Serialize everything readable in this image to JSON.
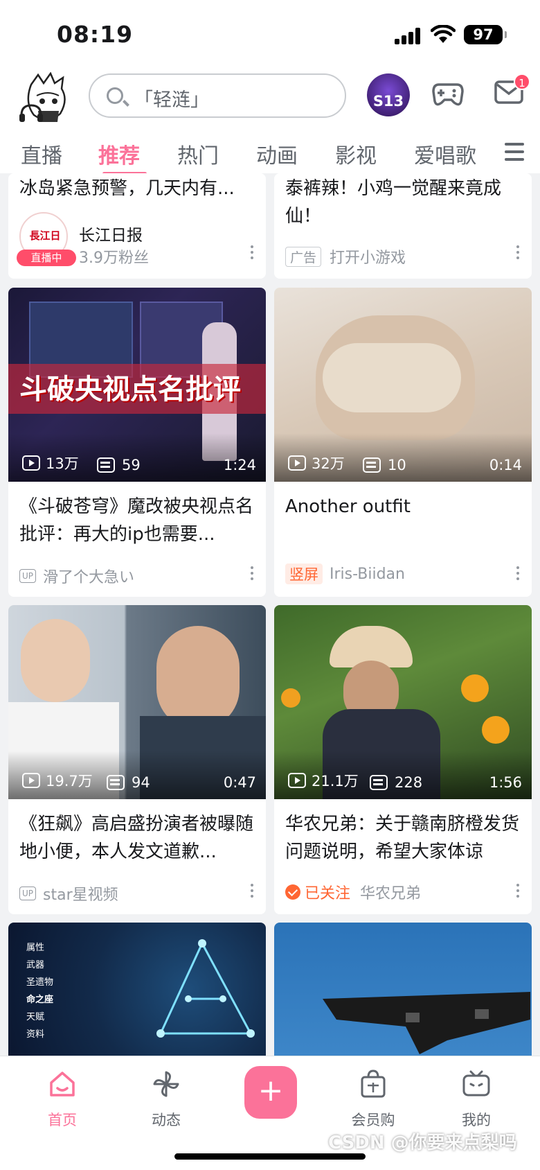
{
  "status_bar": {
    "time": "08:19",
    "battery": "97"
  },
  "header": {
    "search_placeholder": "「轻涟」",
    "event_badge": "S13",
    "mail_count": "1"
  },
  "tabs": [
    "直播",
    "推荐",
    "热门",
    "动画",
    "影视",
    "爱唱歌"
  ],
  "active_tab": "推荐",
  "feed": {
    "c1": {
      "title": "冰岛紧急预警，几天内有...",
      "author": "长江日报",
      "followers": "3.9万粉丝",
      "live_label": "直播中",
      "logo_text": "長江日報"
    },
    "c2": {
      "title": "泰裤辣！小鸡一觉醒来竟成仙！",
      "ad_tag": "广告",
      "action": "打开小游戏"
    },
    "c3": {
      "overlay": "斗破央视点名批评",
      "views": "13万",
      "danmaku": "59",
      "duration": "1:24",
      "title": "《斗破苍穹》魔改被央视点名批评：再大的ip也需要...",
      "author": "滑了个大急い"
    },
    "c4": {
      "views": "32万",
      "danmaku": "10",
      "duration": "0:14",
      "title": "Another outfit",
      "tag": "竖屏",
      "author": "Iris-Biidan"
    },
    "c5": {
      "views": "19.7万",
      "danmaku": "94",
      "duration": "0:47",
      "title": "《狂飙》高启盛扮演者被曝随地小便，本人发文道歉...",
      "author": "star星视频"
    },
    "c6": {
      "views": "21.1万",
      "danmaku": "228",
      "duration": "1:56",
      "title": "华农兄弟：关于赣南脐橙发货问题说明，希望大家体谅",
      "followed": "已关注",
      "author": "华农兄弟"
    },
    "c7": {
      "menu": [
        "属性",
        "武器",
        "圣遗物",
        "命之座",
        "天赋",
        "资料"
      ]
    }
  },
  "up_label": "UP",
  "bottom_nav": {
    "home": "首页",
    "dynamic": "动态",
    "plus": "+",
    "shop": "会员购",
    "mine": "我的"
  },
  "watermark": "CSDN @你要来点梨吗",
  "colors": {
    "accent": "#fb7299",
    "orange": "#ff6633"
  }
}
